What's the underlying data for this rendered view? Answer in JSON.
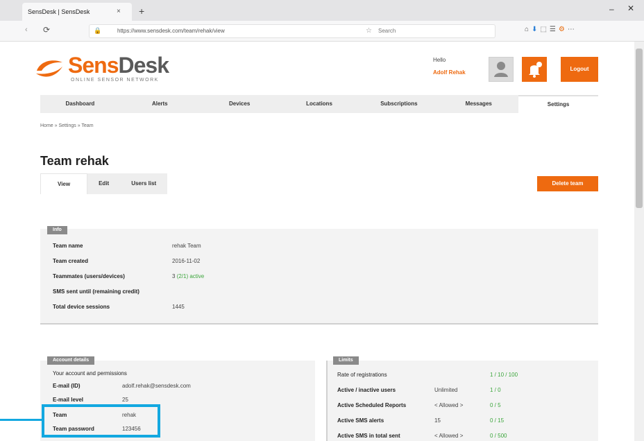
{
  "browser": {
    "tab_title": "SensDesk | SensDesk",
    "tab_close": "×",
    "new_tab": "+",
    "min": "–",
    "close": "✕",
    "back": "‹",
    "reload": "⟳",
    "lock": "🔒",
    "url": "https://www.sensdesk.com/team/rehak/view",
    "star": "☆",
    "search_placeholder": "Search",
    "toolbar_icons": [
      "⌂",
      "⬇",
      "⬚",
      "☰",
      "⚙",
      "⋯"
    ]
  },
  "header": {
    "logo_sens": "Sens",
    "logo_desk": "Desk",
    "tagline": "ONLINE SENSOR NETWORK",
    "greeting": "Hello",
    "user_name": "Adolf Rehak",
    "logout_label": "Logout"
  },
  "menu": {
    "items": [
      "Dashboard",
      "Alerts",
      "Devices",
      "Locations",
      "Subscriptions",
      "Messages",
      "Settings"
    ],
    "active_index": 6
  },
  "breadcrumb": "Home » Settings » Team",
  "page": {
    "title": "Team rehak",
    "tabs": [
      "View",
      "Edit",
      "Users list"
    ],
    "active_tab": 0,
    "action_label": "Delete team"
  },
  "info_panel": {
    "tag": "Info",
    "rows": [
      {
        "k": "Team name",
        "v": "rehak Team",
        "g": ""
      },
      {
        "k": "Team created",
        "v": "2016-11-02",
        "g": ""
      },
      {
        "k": "Teammates (users/devices)",
        "v": "3",
        "g": "(2/1) active"
      },
      {
        "k": "SMS sent until (remaining credit)",
        "v": "",
        "g": ""
      },
      {
        "k": "Total device sessions",
        "v": "1445",
        "g": ""
      }
    ]
  },
  "account_panel": {
    "tag": "Account details",
    "rows": [
      {
        "k": "Your account and permissions",
        "v": "",
        "g": ""
      },
      {
        "k": "E-mail (ID)",
        "v": "adolf.rehak@sensdesk.com",
        "g": ""
      },
      {
        "k": "E-mail level",
        "v": "25",
        "g": ""
      },
      {
        "k": "Team",
        "v": "rehak",
        "g": ""
      },
      {
        "k": "Team password",
        "v": "123456",
        "g": ""
      }
    ]
  },
  "limits_panel": {
    "tag": "Limits",
    "rows": [
      {
        "k": "Rate of registrations",
        "v": "",
        "g": "1 / 10 / 100"
      },
      {
        "k": "Active / inactive users",
        "v": "Unlimited",
        "g": "1 / 0"
      },
      {
        "k": "Active Scheduled Reports",
        "v": "< Allowed >",
        "g": "0 / 5"
      },
      {
        "k": "Active SMS alerts",
        "v": "15",
        "g": "0 / 15"
      },
      {
        "k": "Active SMS in total sent",
        "v": "< Allowed >",
        "g": "0 / 500"
      }
    ]
  }
}
